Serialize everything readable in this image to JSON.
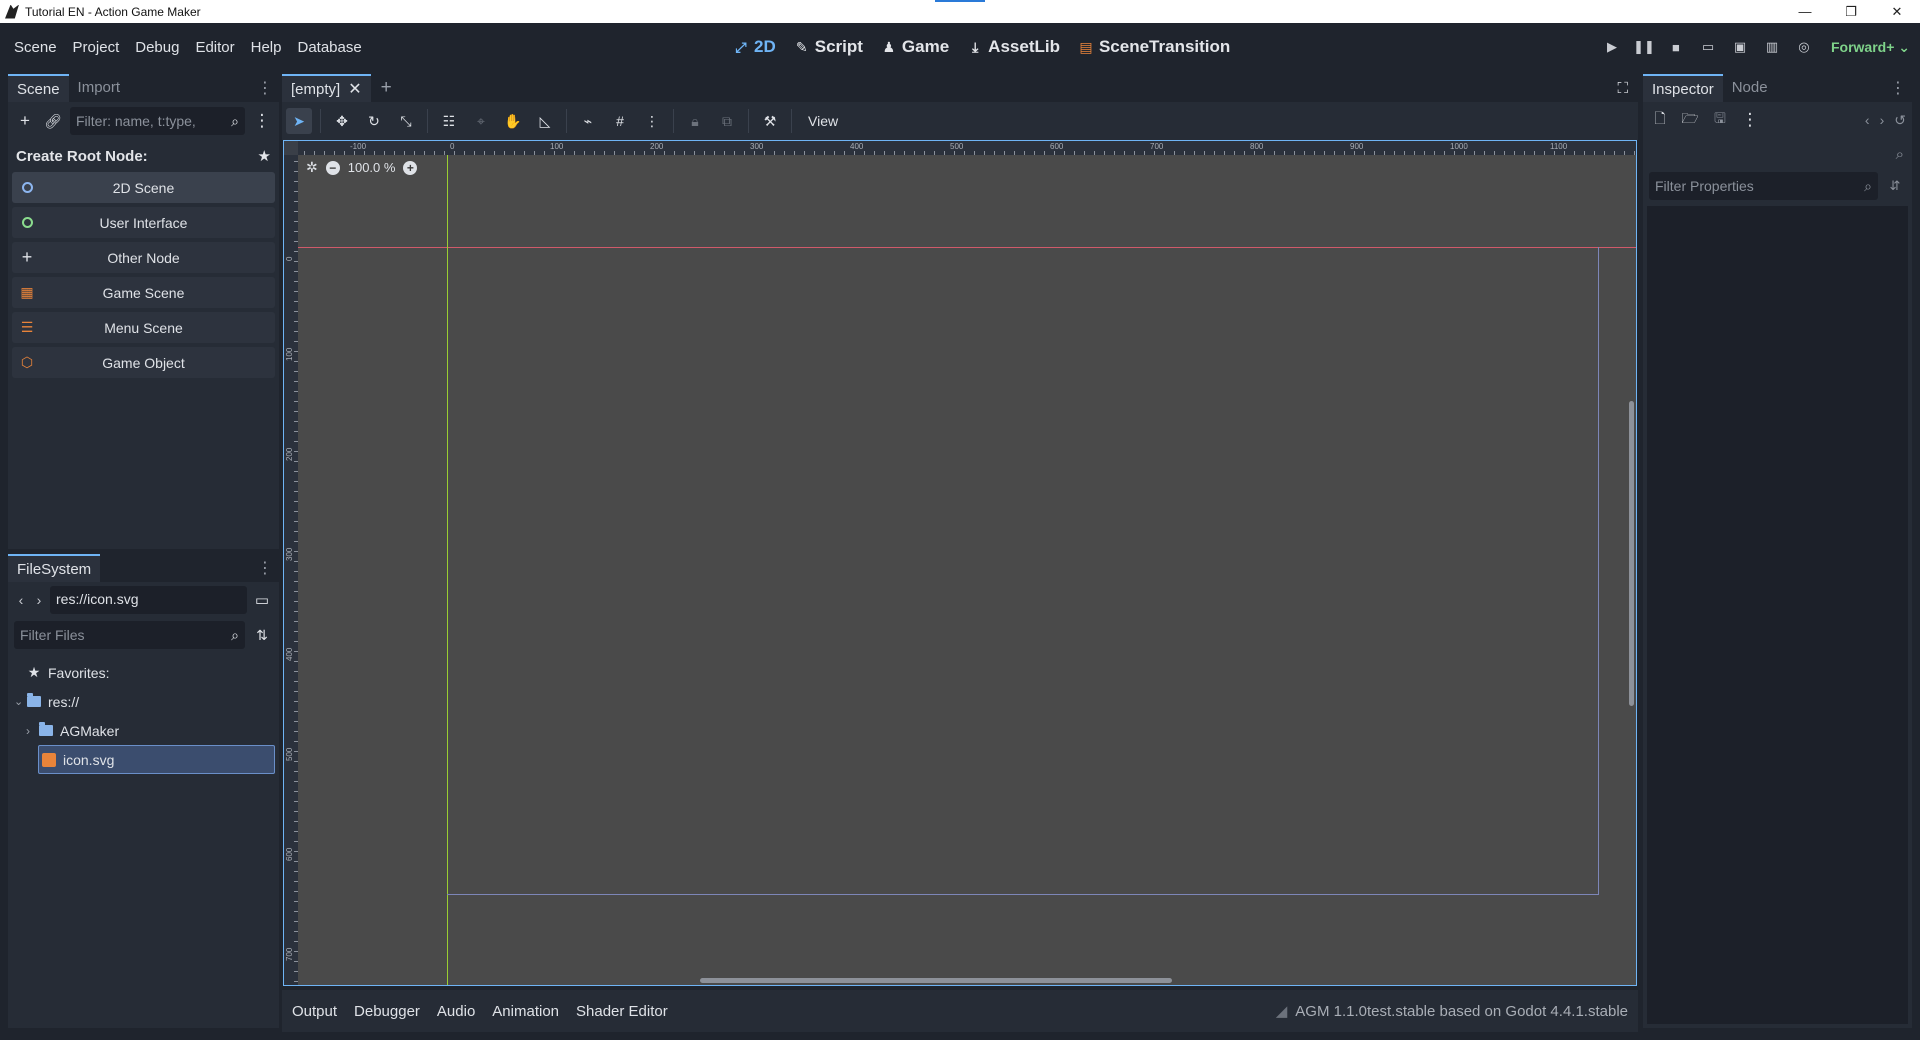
{
  "window": {
    "title": "Tutorial EN - Action Game Maker",
    "controls": [
      "—",
      "❐",
      "✕"
    ]
  },
  "menubar": {
    "menus": [
      "Scene",
      "Project",
      "Debug",
      "Editor",
      "Help",
      "Database"
    ],
    "main_tabs": [
      {
        "label": "2D",
        "icon": "2d-icon",
        "active": true
      },
      {
        "label": "Script",
        "icon": "script-icon"
      },
      {
        "label": "Game",
        "icon": "game-icon"
      },
      {
        "label": "AssetLib",
        "icon": "download-icon"
      },
      {
        "label": "SceneTransition",
        "icon": "scene-transition-icon"
      }
    ],
    "renderer": "Forward+",
    "accent_color": "#6fb4f5"
  },
  "scene_dock": {
    "tabs": [
      "Scene",
      "Import"
    ],
    "filter_placeholder": "Filter: name, t:type,",
    "create_root_label": "Create Root Node:",
    "root_nodes": [
      {
        "label": "2D Scene",
        "icon": "node2d-icon"
      },
      {
        "label": "User Interface",
        "icon": "control-icon"
      },
      {
        "label": "Other Node",
        "icon": "plus-icon"
      },
      {
        "label": "Game Scene",
        "icon": "game-scene-icon"
      },
      {
        "label": "Menu Scene",
        "icon": "menu-scene-icon"
      },
      {
        "label": "Game Object",
        "icon": "game-object-icon"
      }
    ]
  },
  "filesystem": {
    "tab": "FileSystem",
    "path": "res://icon.svg",
    "filter_placeholder": "Filter Files",
    "tree": {
      "favorites": "Favorites:",
      "root": "res://",
      "folder": "AGMaker",
      "file": "icon.svg"
    }
  },
  "editor": {
    "scene_tab": "[empty]",
    "view_menu": "View",
    "zoom": "100.0 %",
    "ruler_h": [
      "-100",
      "0",
      "100",
      "200",
      "300",
      "400",
      "500",
      "600",
      "700",
      "800",
      "900",
      "1000",
      "1100"
    ],
    "ruler_v": [
      "0",
      "100",
      "200",
      "300",
      "400",
      "500",
      "600",
      "700"
    ]
  },
  "bottom_panel": {
    "tabs": [
      "Output",
      "Debugger",
      "Audio",
      "Animation",
      "Shader Editor"
    ],
    "version": "AGM 1.1.0test.stable based on Godot 4.4.1.stable"
  },
  "inspector": {
    "tabs": [
      "Inspector",
      "Node"
    ],
    "filter_placeholder": "Filter Properties"
  }
}
